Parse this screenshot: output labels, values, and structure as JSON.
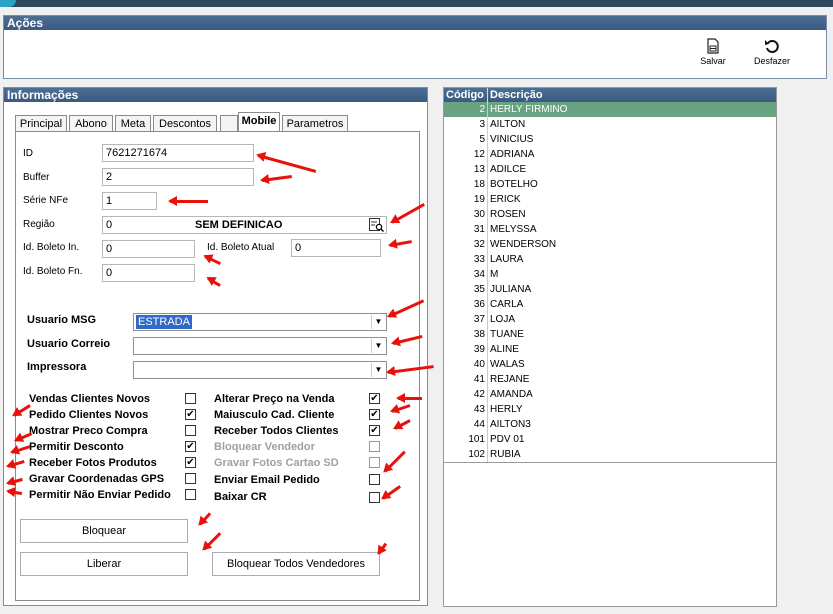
{
  "acoes": {
    "title": "Ações",
    "salvar": "Salvar",
    "desfazer": "Desfazer"
  },
  "info": {
    "title": "Informações",
    "tabs": [
      "Principal",
      "Abono",
      "Meta",
      "Descontos",
      "",
      "Mobile",
      "Parametros"
    ],
    "active_tab": "Mobile",
    "fields": {
      "id_label": "ID",
      "id_value": "7621271674",
      "buffer_label": "Buffer",
      "buffer_value": "2",
      "serie_label": "Série NFe",
      "serie_value": "1",
      "regiao_label": "Região",
      "regiao_code": "0",
      "regiao_name": "SEM DEFINICAO",
      "boleto_in_label": "Id. Boleto In.",
      "boleto_in_value": "0",
      "boleto_atual_label": "Id. Boleto Atual",
      "boleto_atual_value": "0",
      "boleto_fn_label": "Id. Boleto Fn.",
      "boleto_fn_value": "0",
      "usuario_msg_label": "Usuario MSG",
      "usuario_msg_value": "ESTRADA",
      "usuario_correio_label": "Usuario Correio",
      "usuario_correio_value": "",
      "impressora_label": "Impressora",
      "impressora_value": ""
    },
    "left_checks": [
      {
        "label": "Vendas Clientes Novos",
        "checked": false,
        "disabled": false
      },
      {
        "label": "Pedido Clientes Novos",
        "checked": true,
        "disabled": false
      },
      {
        "label": "Mostrar Preco Compra",
        "checked": false,
        "disabled": false
      },
      {
        "label": "Permitir Desconto",
        "checked": true,
        "disabled": false
      },
      {
        "label": "Receber Fotos  Produtos",
        "checked": true,
        "disabled": false
      },
      {
        "label": "Gravar Coordenadas GPS",
        "checked": false,
        "disabled": false
      },
      {
        "label": "Permitir Não Enviar Pedido",
        "checked": false,
        "disabled": false
      }
    ],
    "right_checks": [
      {
        "label": "Alterar Preço na Venda",
        "checked": true,
        "disabled": false
      },
      {
        "label": "Maiusculo Cad. Cliente",
        "checked": true,
        "disabled": false
      },
      {
        "label": "Receber Todos Clientes",
        "checked": true,
        "disabled": false
      },
      {
        "label": "Bloquear Vendedor",
        "checked": false,
        "disabled": true
      },
      {
        "label": "Gravar Fotos Cartao SD",
        "checked": false,
        "disabled": true
      },
      {
        "label": "Enviar Email Pedido",
        "checked": false,
        "disabled": false
      },
      {
        "label": "Baixar CR",
        "checked": false,
        "disabled": false
      }
    ],
    "buttons": {
      "bloquear": "Bloquear",
      "liberar": "Liberar",
      "bloquear_todos": "Bloquear Todos Vendedores"
    }
  },
  "grid": {
    "col_codigo": "Código",
    "col_descricao": "Descrição",
    "rows": [
      {
        "codigo": "2",
        "descricao": "HERLY  FIRMINO",
        "selected": true
      },
      {
        "codigo": "3",
        "descricao": "AILTON"
      },
      {
        "codigo": "5",
        "descricao": "VINICIUS"
      },
      {
        "codigo": "12",
        "descricao": "ADRIANA"
      },
      {
        "codigo": "13",
        "descricao": "ADILCE"
      },
      {
        "codigo": "18",
        "descricao": "BOTELHO"
      },
      {
        "codigo": "19",
        "descricao": "ERICK"
      },
      {
        "codigo": "30",
        "descricao": "ROSEN"
      },
      {
        "codigo": "31",
        "descricao": "MELYSSA"
      },
      {
        "codigo": "32",
        "descricao": "WENDERSON"
      },
      {
        "codigo": "33",
        "descricao": "LAURA"
      },
      {
        "codigo": "34",
        "descricao": "M"
      },
      {
        "codigo": "35",
        "descricao": "JULIANA"
      },
      {
        "codigo": "36",
        "descricao": "CARLA"
      },
      {
        "codigo": "37",
        "descricao": "LOJA"
      },
      {
        "codigo": "38",
        "descricao": "TUANE"
      },
      {
        "codigo": "39",
        "descricao": "ALINE"
      },
      {
        "codigo": "40",
        "descricao": "WALAS"
      },
      {
        "codigo": "41",
        "descricao": "REJANE"
      },
      {
        "codigo": "42",
        "descricao": "AMANDA"
      },
      {
        "codigo": "43",
        "descricao": "HERLY"
      },
      {
        "codigo": "44",
        "descricao": "AILTON3"
      },
      {
        "codigo": "101",
        "descricao": "PDV 01"
      },
      {
        "codigo": "102",
        "descricao": "RUBIA"
      }
    ]
  },
  "icons": {
    "salvar": "save-file-icon",
    "desfazer": "undo-icon",
    "search": "search-list-icon"
  },
  "colors": {
    "title_bar": "#3a5a80",
    "selection": "#6aa381",
    "annotation_arrow": "#e8120c"
  }
}
